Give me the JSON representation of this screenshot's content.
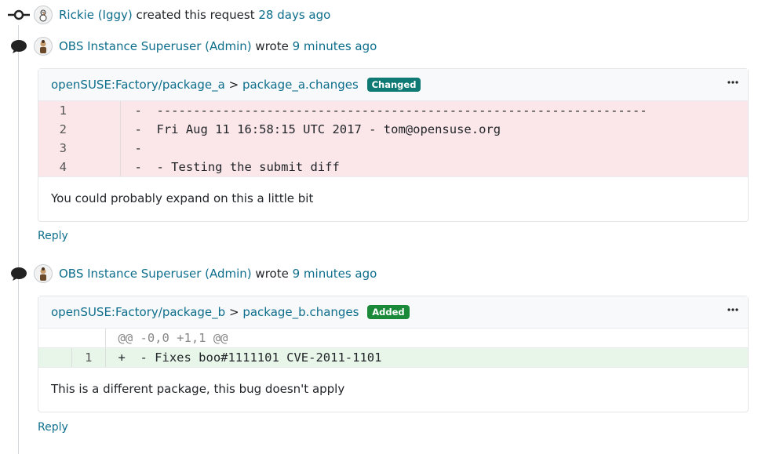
{
  "events": [
    {
      "user": "Rickie (Iggy)",
      "action": "created this request",
      "time": "28 days ago"
    },
    {
      "user": "OBS Instance Superuser (Admin)",
      "action": "wrote",
      "time": "9 minutes ago"
    },
    {
      "user": "OBS Instance Superuser (Admin)",
      "action": "wrote",
      "time": "9 minutes ago"
    }
  ],
  "comments": [
    {
      "project": "openSUSE:Factory/package_a",
      "separator": ">",
      "file": "package_a.changes",
      "badge": "Changed",
      "badge_color": "#0f7a74",
      "diff_lines": [
        {
          "old": "1",
          "new": "",
          "text": "-  -------------------------------------------------------------------"
        },
        {
          "old": "2",
          "new": "",
          "text": "-  Fri Aug 11 16:58:15 UTC 2017 - tom@opensuse.org"
        },
        {
          "old": "3",
          "new": "",
          "text": "-"
        },
        {
          "old": "4",
          "new": "",
          "text": "-  - Testing the submit diff"
        }
      ],
      "body": "You could probably expand on this a little bit",
      "reply": "Reply"
    },
    {
      "project": "openSUSE:Factory/package_b",
      "separator": ">",
      "file": "package_b.changes",
      "badge": "Added",
      "badge_color": "#1a8a3a",
      "hunk": "@@ -0,0 +1,1 @@",
      "diff_lines": [
        {
          "old": "",
          "new": "1",
          "text": "+  - Fixes boo#1111101 CVE-2011-1101"
        }
      ],
      "body": "This is a different package, this bug doesn't apply",
      "reply": "Reply"
    }
  ],
  "icons": {
    "commit": "commit-icon",
    "comment": "comment-icon",
    "menu": "ellipsis-icon"
  },
  "colors": {
    "link": "#0d6e8c",
    "deleted_row": "#fbe7e9",
    "added_row": "#e8f5e9"
  }
}
